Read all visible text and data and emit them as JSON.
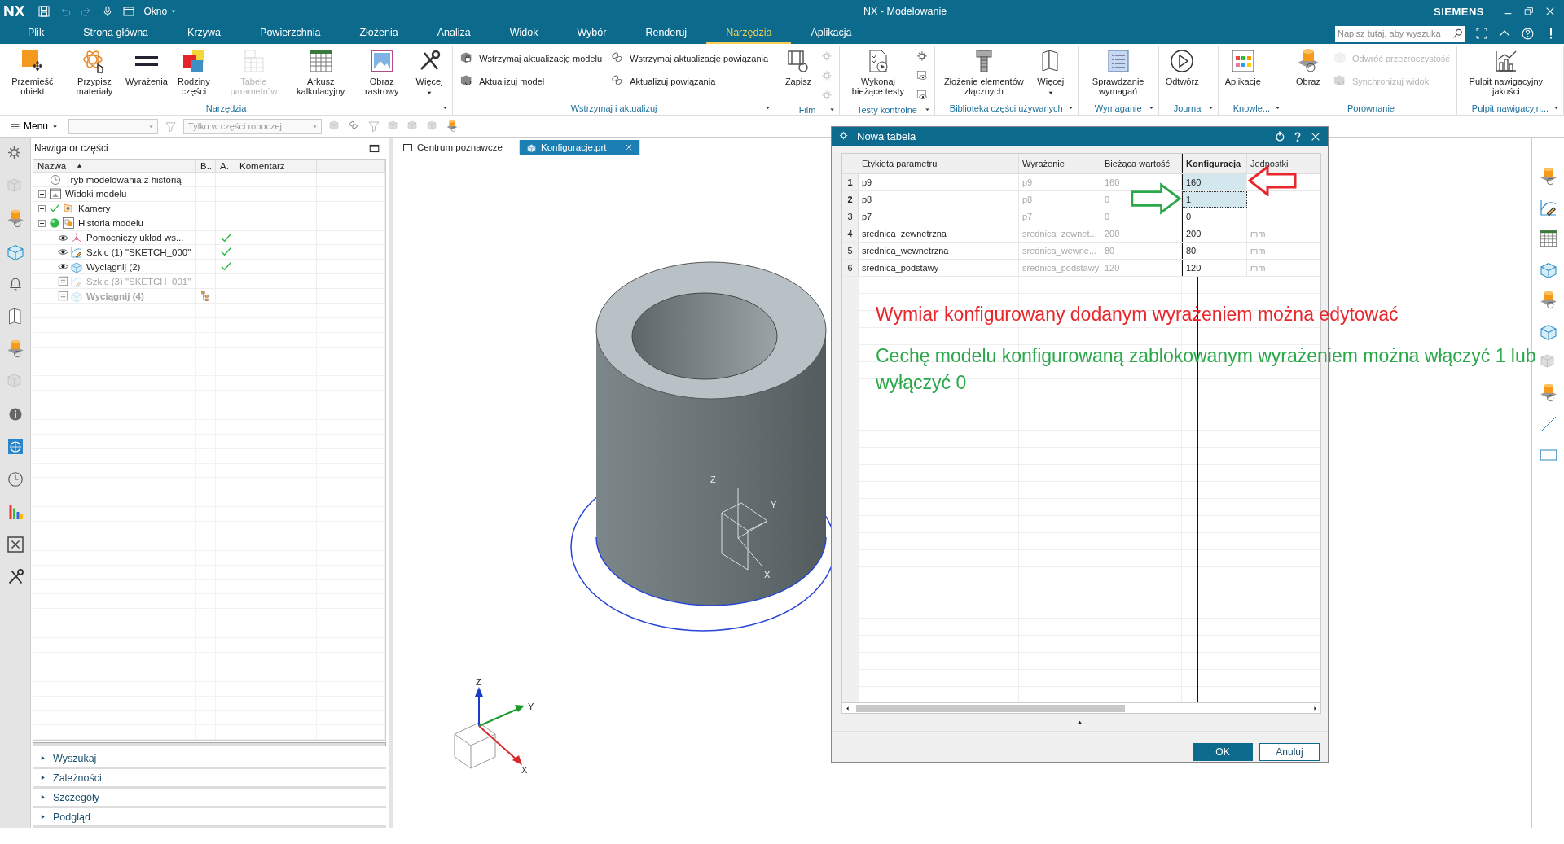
{
  "app": {
    "logo": "NX",
    "window_menu": "Okno",
    "title": "NX - Modelowanie",
    "brand": "SIEMENS",
    "search_placeholder": "Napisz tutaj, aby wyszuka"
  },
  "menu_tabs": [
    {
      "label": "Plik",
      "selected": false
    },
    {
      "label": "Strona główna",
      "selected": false
    },
    {
      "label": "Krzywa",
      "selected": false
    },
    {
      "label": "Powierzchnia",
      "selected": false
    },
    {
      "label": "Złożenia",
      "selected": false
    },
    {
      "label": "Analiza",
      "selected": false
    },
    {
      "label": "Widok",
      "selected": false
    },
    {
      "label": "Wybór",
      "selected": false
    },
    {
      "label": "Renderuj",
      "selected": false
    },
    {
      "label": "Narzędzia",
      "selected": true
    },
    {
      "label": "Aplikacja",
      "selected": false
    }
  ],
  "ribbon_groups": [
    {
      "label": "Narzędzia",
      "menu": true,
      "items": [
        {
          "kind": "large",
          "label": "Przemieść obiekt",
          "disabled": false
        },
        {
          "kind": "large",
          "label": "Przypisz materiały",
          "disabled": false
        },
        {
          "kind": "large",
          "label": "Wyrażenia",
          "disabled": false
        },
        {
          "kind": "large",
          "label": "Rodziny części",
          "disabled": false
        },
        {
          "kind": "large",
          "label": "Tabele parametrów",
          "disabled": true
        },
        {
          "kind": "large",
          "label": "Arkusz kalkulacyjny",
          "disabled": false
        },
        {
          "kind": "large",
          "label": "Obraz rastrowy",
          "disabled": false
        },
        {
          "kind": "large",
          "label": "Więcej",
          "disabled": false,
          "dropdown": true
        }
      ]
    },
    {
      "label": "Wstrzymaj i aktualizuj",
      "menu": true,
      "items": [
        {
          "kind": "small",
          "label": "Wstrzymaj aktualizację modelu",
          "disabled": false
        },
        {
          "kind": "small",
          "label": "Aktualizuj model",
          "disabled": false
        },
        {
          "kind": "small",
          "label": "Wstrzymaj aktualizację powiązania",
          "disabled": false
        },
        {
          "kind": "small",
          "label": "Aktualizuj powiązania",
          "disabled": false
        }
      ]
    },
    {
      "label": "Film",
      "menu": true,
      "items": [
        {
          "kind": "large",
          "label": "Zapisz",
          "disabled": false
        },
        {
          "kind": "icon",
          "disabled": true
        },
        {
          "kind": "icon",
          "disabled": true
        },
        {
          "kind": "icon",
          "disabled": true
        }
      ]
    },
    {
      "label": "Testy kontrolne",
      "menu": true,
      "items": [
        {
          "kind": "large",
          "label": "Wykonaj bieżące testy",
          "disabled": false
        },
        {
          "kind": "icon",
          "disabled": false
        },
        {
          "kind": "icon",
          "disabled": false
        },
        {
          "kind": "icon",
          "disabled": false
        }
      ]
    },
    {
      "label": "Biblioteka części używanych",
      "menu": true,
      "items": [
        {
          "kind": "large",
          "label": "Złożenie elementów złącznych",
          "disabled": false
        },
        {
          "kind": "large",
          "label": "Więcej",
          "disabled": false,
          "dropdown": true
        }
      ]
    },
    {
      "label": "Wymaganie",
      "menu": true,
      "items": [
        {
          "kind": "large",
          "label": "Sprawdzanie wymagań",
          "disabled": false
        }
      ]
    },
    {
      "label": "Journal",
      "menu": true,
      "items": [
        {
          "kind": "large",
          "label": "Odtwórz",
          "disabled": false
        }
      ]
    },
    {
      "label": "Knowle...",
      "menu": true,
      "items": [
        {
          "kind": "large",
          "label": "Aplikacje",
          "disabled": false
        }
      ]
    },
    {
      "label": "Porównanie",
      "menu": false,
      "items": [
        {
          "kind": "large",
          "label": "Obraz",
          "disabled": false
        },
        {
          "kind": "small",
          "label": "Odwróć przezroczystość",
          "disabled": true
        },
        {
          "kind": "small",
          "label": "Synchronizuj widok",
          "disabled": true
        }
      ]
    },
    {
      "label": "Pulpit nawigacyjn...",
      "menu": true,
      "items": [
        {
          "kind": "large",
          "label": "Pulpit nawigacyjny jakości",
          "disabled": false
        }
      ]
    }
  ],
  "toolbar": {
    "menu": "Menu",
    "filter_placeholder": "Tylko w części roboczej"
  },
  "navigator": {
    "title": "Nawigator części",
    "columns": [
      "Nazwa",
      "B..",
      "A.",
      "Komentarz"
    ],
    "tree": [
      {
        "kind": "clock",
        "label": "Tryb modelowania z historią"
      },
      {
        "kind": "views",
        "label": "Widoki modelu",
        "expanded": false
      },
      {
        "kind": "cameras",
        "label": "Kamery",
        "expanded": false
      },
      {
        "kind": "history",
        "label": "Historia modelu",
        "expanded": true,
        "children": [
          {
            "kind": "csys",
            "label": "Pomocniczy układ ws...",
            "visible": true,
            "suppressed": false,
            "up_to_date": true,
            "current": false
          },
          {
            "kind": "sketch",
            "label": "Szkic (1) \"SKETCH_000\"",
            "visible": true,
            "suppressed": false,
            "up_to_date": true,
            "current": false
          },
          {
            "kind": "extrude",
            "label": "Wyciągnij (2)",
            "visible": true,
            "suppressed": false,
            "up_to_date": true,
            "current": false
          },
          {
            "kind": "sketch",
            "label": "Szkic (3) \"SKETCH_001\"",
            "visible": false,
            "suppressed": true,
            "up_to_date": false,
            "current": false
          },
          {
            "kind": "extrude",
            "label": "Wyciągnij (4)",
            "visible": false,
            "suppressed": true,
            "up_to_date": false,
            "current": true
          }
        ]
      }
    ],
    "sections": [
      {
        "label": "Wyszukaj",
        "expanded": false
      },
      {
        "label": "Zależności",
        "expanded": false
      },
      {
        "label": "Szczegóły",
        "expanded": false
      },
      {
        "label": "Podgląd",
        "expanded": false
      }
    ]
  },
  "viewport": {
    "tabs": [
      {
        "label": "Centrum poznawcze",
        "selected": false
      },
      {
        "label": "Konfiguracje.prt",
        "selected": true
      }
    ],
    "sketch_axes": [
      "Z",
      "Y",
      "X"
    ],
    "triad_axes": [
      "Z",
      "Y",
      "X"
    ]
  },
  "dialog": {
    "title": "Nowa tabela",
    "columns": [
      "Etykieta parametru",
      "Wyrażenie",
      "Bieżąca wartość",
      "Konfiguracja",
      "Jednostki"
    ],
    "rows": [
      {
        "number": "1",
        "label": "p9",
        "expression": "p9",
        "current": "160",
        "config": "160",
        "selected": true,
        "focused": false
      },
      {
        "number": "2",
        "label": "p8",
        "expression": "p8",
        "current": "0",
        "config": "1",
        "selected": true,
        "focused": true
      },
      {
        "number": "3",
        "label": "p7",
        "expression": "p7",
        "current": "0",
        "config": "0",
        "selected": false,
        "focused": false
      },
      {
        "number": "4",
        "label": "srednica_zewnetrzna",
        "expression": "srednica_zewnet...",
        "current": "200",
        "config": "200",
        "units": "mm",
        "selected": false,
        "focused": false
      },
      {
        "number": "5",
        "label": "srednica_wewnetrzna",
        "expression": "srednica_wewne...",
        "current": "80",
        "config": "80",
        "units": "mm",
        "selected": false,
        "focused": false
      },
      {
        "number": "6",
        "label": "srednica_podstawy",
        "expression": "srednica_podstawy",
        "current": "120",
        "config": "120",
        "units": "mm",
        "selected": false,
        "focused": false
      }
    ],
    "buttons": [
      "OK",
      "Anuluj"
    ]
  },
  "annotations": [
    {
      "text": "Wymiar konfigurowany dodanym wyrażeniem można edytować",
      "color": "#e8262b"
    },
    {
      "text": "Cechę modelu konfigurowaną zablokowanym wyrażeniem można włączyć 1 lub wyłączyć 0",
      "color": "#2aa84a"
    }
  ]
}
